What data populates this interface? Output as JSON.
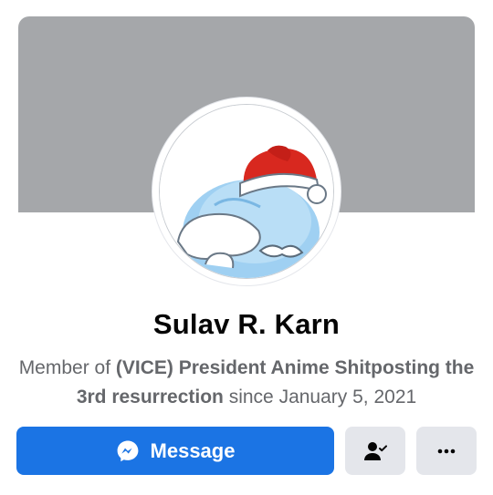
{
  "profile": {
    "name": "Sulav R. Karn",
    "membership": {
      "prefix": "Member of ",
      "group_name": "(VICE) President Anime Shitposting the 3rd resurrection",
      "since_text": " since January 5, 2021"
    }
  },
  "actions": {
    "message_label": "Message",
    "message_icon": "messenger-icon",
    "friend_icon": "friend-check-icon",
    "more_icon": "more-icon"
  },
  "colors": {
    "cover": "#a5a7aa",
    "primary_button": "#1b74e4",
    "secondary_button": "#e4e6eb"
  }
}
